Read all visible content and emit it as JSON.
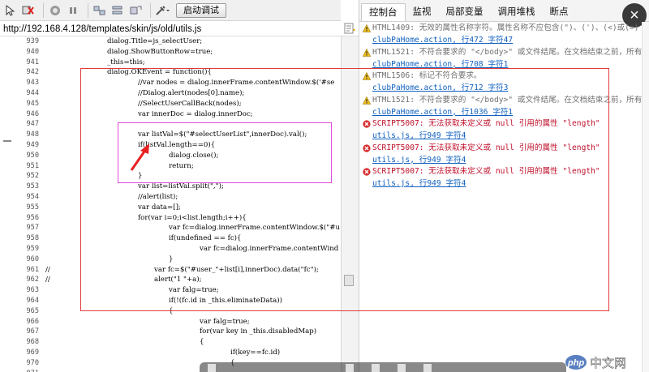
{
  "toolbar": {
    "start_debug_label": "启动调试",
    "icons": [
      "pointer-icon",
      "clear-breakpoint-icon",
      "record-icon",
      "pause-icon",
      "step-into-icon",
      "step-over-icon",
      "step-out-icon",
      "settings-icon"
    ]
  },
  "urlbar": {
    "url": "http://192.168.4.128/templates/skin/js/old/utils.js"
  },
  "code": {
    "lines": [
      {
        "ln": "939",
        "gm": "",
        "indent": 132,
        "text": "dialog.Title=js_selectUser;"
      },
      {
        "ln": "940",
        "gm": "",
        "indent": 132,
        "text": "dialog.ShowButtonRow=true;"
      },
      {
        "ln": "941",
        "gm": "",
        "indent": 132,
        "text": "_this=this;"
      },
      {
        "ln": "942",
        "gm": "",
        "indent": 132,
        "text": "dialog.OKEvent = function(){"
      },
      {
        "ln": "943",
        "gm": "",
        "indent": 170,
        "text": "//var nodes = dialog.innerFrame.contentWindow.$('#se"
      },
      {
        "ln": "944",
        "gm": "",
        "indent": 170,
        "text": "//Dialog.alert(nodes[0].name);"
      },
      {
        "ln": "945",
        "gm": "",
        "indent": 170,
        "text": "//SelectUserCallBack(nodes);"
      },
      {
        "ln": "946",
        "gm": "",
        "indent": 170,
        "text": "var innerDoc = dialog.innerDoc;"
      },
      {
        "ln": "947",
        "gm": "",
        "indent": 170,
        "text": ""
      },
      {
        "ln": "948",
        "gm": "",
        "indent": 170,
        "text": "var listVal=$(\"#selectUserList\",innerDoc).val();"
      },
      {
        "ln": "949",
        "gm": "",
        "indent": 170,
        "text": "if(listVal.length==0){"
      },
      {
        "ln": "950",
        "gm": "",
        "indent": 208,
        "text": "dialog.close();"
      },
      {
        "ln": "951",
        "gm": "",
        "indent": 208,
        "text": "return;"
      },
      {
        "ln": "952",
        "gm": "",
        "indent": 170,
        "text": "}"
      },
      {
        "ln": "953",
        "gm": "",
        "indent": 170,
        "text": "var list=listVal.split(\",\");"
      },
      {
        "ln": "954",
        "gm": "",
        "indent": 170,
        "text": "//alert(list);"
      },
      {
        "ln": "955",
        "gm": "",
        "indent": 170,
        "text": "var data=[];"
      },
      {
        "ln": "956",
        "gm": "",
        "indent": 170,
        "text": "for(var i=0;i<list.length;i++){"
      },
      {
        "ln": "957",
        "gm": "",
        "indent": 208,
        "text": "var fc=dialog.innerFrame.contentWindow.$(\"#u"
      },
      {
        "ln": "958",
        "gm": "",
        "indent": 208,
        "text": "if(undefined == fc){"
      },
      {
        "ln": "959",
        "gm": "",
        "indent": 246,
        "text": "var fc=dialog.innerFrame.contentWind"
      },
      {
        "ln": "960",
        "gm": "",
        "indent": 208,
        "text": "}"
      },
      {
        "ln": "961",
        "gm": "//",
        "indent": 190,
        "text": "var fc=$(\"#user_\"+list[i],innerDoc).data(\"fc\");"
      },
      {
        "ln": "962",
        "gm": "//",
        "indent": 190,
        "text": "alert(\"1 \"+a);"
      },
      {
        "ln": "963",
        "gm": "",
        "indent": 208,
        "text": "var falg=true;"
      },
      {
        "ln": "964",
        "gm": "",
        "indent": 208,
        "text": "if(!(fc.id in _this.eliminateData))"
      },
      {
        "ln": "965",
        "gm": "",
        "indent": 208,
        "text": "{"
      },
      {
        "ln": "966",
        "gm": "",
        "indent": 246,
        "text": "var falg=true;"
      },
      {
        "ln": "967",
        "gm": "",
        "indent": 246,
        "text": "for(var key in _this.disabledMap)"
      },
      {
        "ln": "968",
        "gm": "",
        "indent": 246,
        "text": "{"
      },
      {
        "ln": "969",
        "gm": "",
        "indent": 284,
        "text": "if(key==fc.id)"
      },
      {
        "ln": "970",
        "gm": "",
        "indent": 284,
        "text": "{"
      },
      {
        "ln": "971",
        "gm": "",
        "indent": 284,
        "text": ""
      }
    ]
  },
  "console": {
    "tabs": [
      "控制台",
      "监视",
      "局部变量",
      "调用堆栈",
      "断点"
    ],
    "active_tab": 0,
    "messages": [
      {
        "level": "warning",
        "text": "HTML1409: 无效的属性名称字符。属性名称不应包含(\")、(')、(<)或(=)",
        "link": "clubPaHome.action, 行472 字符47"
      },
      {
        "level": "warning",
        "text": "HTML1521: 不符合要求的 \"</body>\" 或文件结尾。在文档结束之前，所有",
        "link": "clubPaHome.action, 行708 字符1"
      },
      {
        "level": "warning",
        "text": "HTML1506: 标记不符合要求。",
        "link": "clubPaHome.action, 行712 字符3"
      },
      {
        "level": "warning",
        "text": "HTML1521: 不符合要求的 \"</body>\" 或文件结尾。在文档结束之前，所有",
        "link": "clubPaHome.action, 行1036 字符1"
      },
      {
        "level": "error",
        "text": "SCRIPT5007: 无法获取未定义或 null 引用的属性 \"length\"",
        "link": "utils.js, 行949 字符4"
      },
      {
        "level": "error",
        "text": "SCRIPT5007: 无法获取未定义或 null 引用的属性 \"length\"",
        "link": "utils.js, 行949 字符4"
      },
      {
        "level": "error",
        "text": "SCRIPT5007: 无法获取未定义或 null 引用的属性 \"length\"",
        "link": "utils.js, 行949 字符4"
      }
    ]
  },
  "colors": {
    "annotation_red": "#e23a3a",
    "annotation_pink": "#e24be0",
    "error": "#c0102a",
    "link": "#1060c0"
  }
}
